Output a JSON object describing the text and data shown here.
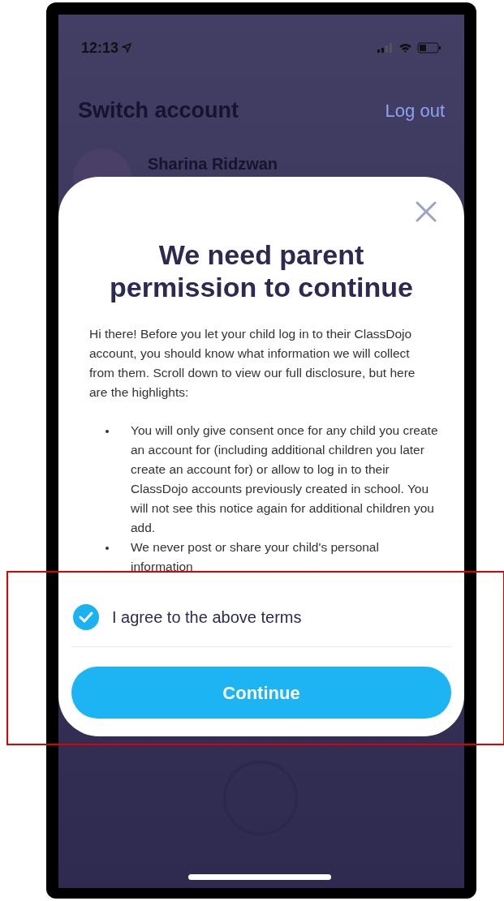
{
  "status_bar": {
    "time": "12:13"
  },
  "background": {
    "title": "Switch account",
    "action": "Log out",
    "account_name": "Sharina Ridzwan"
  },
  "dialog": {
    "title": "We need parent permission to continue",
    "intro": "Hi there! Before you let your child log in to their ClassDojo account, you should know what information we will collect from them. Scroll down to view our full disclosure, but here are the highlights:",
    "bullets": [
      "You will only give consent once for any child you create an account for (including additional children you later create an account for) or allow to log in to their ClassDojo accounts previously created in school. You will not see this notice again for additional children you add.",
      "We never post or share your child's personal information"
    ],
    "agree": {
      "label": "I agree to the above terms",
      "checked": true
    },
    "button": "Continue"
  }
}
